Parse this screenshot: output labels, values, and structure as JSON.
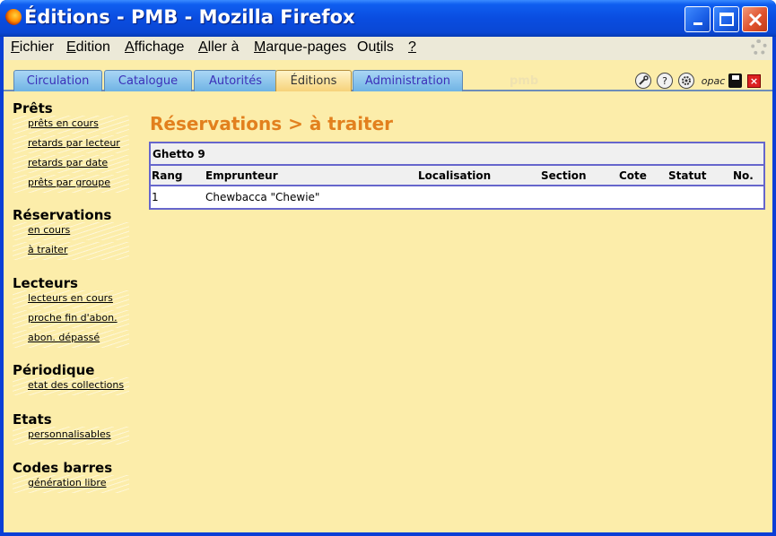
{
  "window": {
    "title": "Éditions - PMB - Mozilla Firefox"
  },
  "menubar": {
    "items": [
      {
        "pre": "",
        "key": "F",
        "post": "ichier"
      },
      {
        "pre": "",
        "key": "E",
        "post": "dition"
      },
      {
        "pre": "",
        "key": "A",
        "post": "ffichage"
      },
      {
        "pre": "",
        "key": "A",
        "post": "ller à"
      },
      {
        "pre": "",
        "key": "M",
        "post": "arque-pages"
      },
      {
        "pre": "Ou",
        "key": "t",
        "post": "ils"
      },
      {
        "pre": "",
        "key": "?",
        "post": ""
      }
    ]
  },
  "tabs": [
    {
      "label": "Circulation",
      "active": false
    },
    {
      "label": "Catalogue",
      "active": false
    },
    {
      "label": "Autorités",
      "active": false
    },
    {
      "label": "Éditions",
      "active": true
    },
    {
      "label": "Administration",
      "active": false
    }
  ],
  "toolbar": {
    "logo": "pmb",
    "opac_label": "opac",
    "help_label": "?",
    "close_label": "×"
  },
  "nav": {
    "sections": [
      {
        "title": "Prêts",
        "links": [
          "prêts en cours",
          "retards par lecteur",
          "retards par date",
          "prêts par groupe"
        ]
      },
      {
        "title": "Réservations",
        "links": [
          "en cours",
          "à traiter"
        ]
      },
      {
        "title": "Lecteurs",
        "links": [
          "lecteurs en cours",
          "proche fin d'abon.",
          "abon. dépassé"
        ]
      },
      {
        "title": "Périodique",
        "links": [
          "etat des collections"
        ]
      },
      {
        "title": "Etats",
        "links": [
          "personnalisables"
        ]
      },
      {
        "title": "Codes barres",
        "links": [
          "génération libre"
        ]
      }
    ]
  },
  "main": {
    "title": "Réservations > à traiter",
    "group_label": "Ghetto 9",
    "columns": [
      "Rang",
      "Emprunteur",
      "Localisation",
      "Section",
      "Cote",
      "Statut",
      "No."
    ],
    "rows": [
      [
        "1",
        "Chewbacca \"Chewie\"",
        "",
        "",
        "",
        "",
        ""
      ]
    ]
  },
  "colors": {
    "page_bg": "#fcedaa",
    "title_accent": "#e2801e",
    "table_border": "#6666cc",
    "tab_active": "#f6d27a",
    "tab_inactive": "#6fb3e4"
  }
}
